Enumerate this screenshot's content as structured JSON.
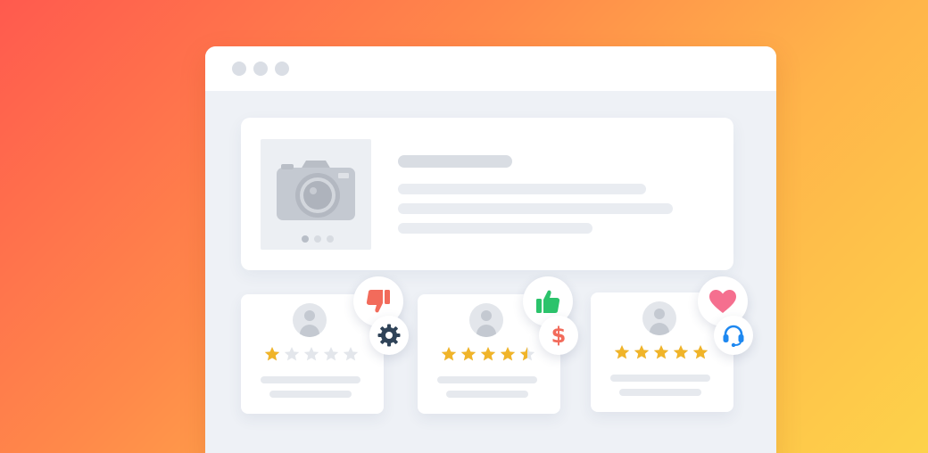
{
  "window": {
    "controls": [
      "window-dot",
      "window-dot",
      "window-dot"
    ]
  },
  "product": {
    "image_icon": "camera-icon",
    "carousel_dots": 3,
    "carousel_active_index": 0
  },
  "reviews": [
    {
      "rating": 1,
      "max_rating": 5,
      "reaction_icon": "thumbs-down-icon",
      "category_icon": "gear-icon"
    },
    {
      "rating": 4.5,
      "max_rating": 5,
      "reaction_icon": "thumbs-up-icon",
      "category_icon": "dollar-icon",
      "category_symbol": "$"
    },
    {
      "rating": 5,
      "max_rating": 5,
      "reaction_icon": "heart-icon",
      "category_icon": "headset-icon"
    }
  ],
  "colors": {
    "star_filled": "#f0b429",
    "star_empty": "#e3e6eb",
    "thumbs_down": "#f26b5b",
    "thumbs_up": "#2bc36b",
    "heart": "#f56f8f",
    "gear": "#2f4358",
    "dollar": "#f26b5b",
    "headset": "#1e88f0"
  }
}
